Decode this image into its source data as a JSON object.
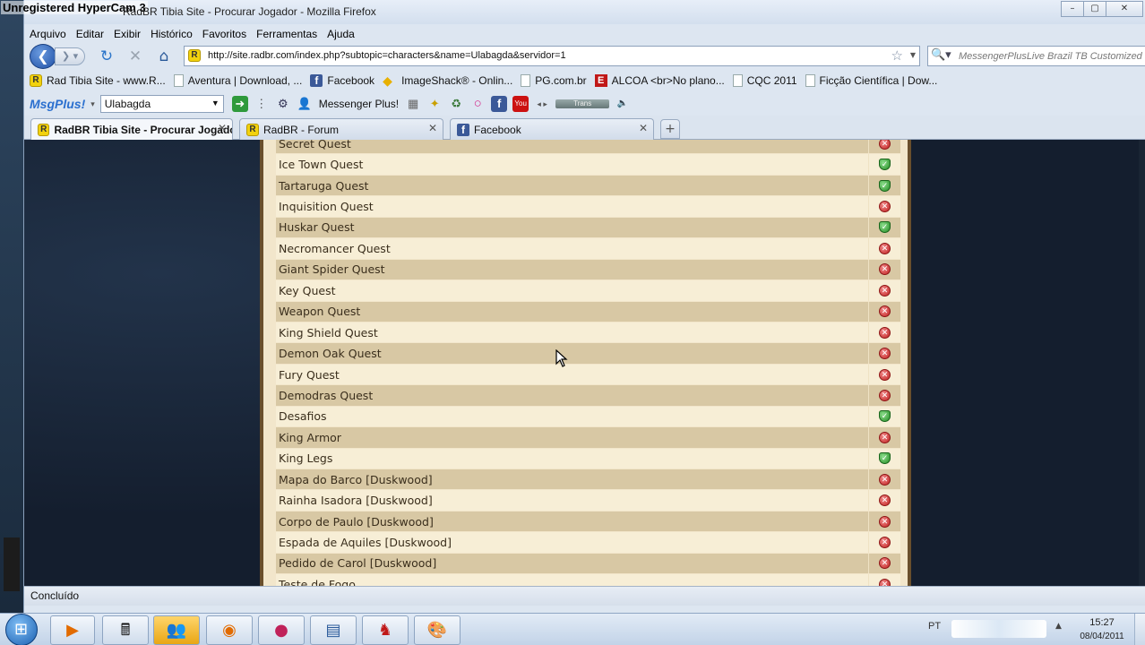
{
  "watermark": "Unregistered HyperCam 3",
  "window": {
    "title": "RadBR Tibia Site - Procurar Jogador - Mozilla Firefox",
    "minimize": "–",
    "maximize": "▢",
    "close": "✕"
  },
  "menu": [
    "Arquivo",
    "Editar",
    "Exibir",
    "Histórico",
    "Favoritos",
    "Ferramentas",
    "Ajuda"
  ],
  "nav": {
    "url": "http://site.radbr.com/index.php?subtopic=characters&name=Ulabagda&servidor=1",
    "search_placeholder": "MessengerPlusLive Brazil TB Customized"
  },
  "bookmarks": [
    {
      "label": "Rad Tibia Site - www.R...",
      "icon": "rad-favicon"
    },
    {
      "label": "Aventura | Download, ...",
      "icon": "page-icon"
    },
    {
      "label": "Facebook",
      "icon": "facebook-icon"
    },
    {
      "label": "ImageShack® - Onlin...",
      "icon": "imageshack-icon"
    },
    {
      "label": "PG.com.br",
      "icon": "page-icon"
    },
    {
      "label": "ALCOA <br>No plano...",
      "icon": "e-icon"
    },
    {
      "label": "CQC 2011",
      "icon": "page-icon"
    },
    {
      "label": "Ficção Científica | Dow...",
      "icon": "page-icon"
    }
  ],
  "msgplus": {
    "logo": "MsgPlus!",
    "search_value": "Ulabagda",
    "messenger_label": "Messenger Plus!",
    "trans_label": "Trans"
  },
  "tabs": [
    {
      "label": "RadBR Tibia Site - Procurar Jogador",
      "active": true
    },
    {
      "label": "RadBR - Forum",
      "active": false
    },
    {
      "label": "Facebook",
      "active": false
    }
  ],
  "quests": [
    {
      "name": "Secret Quest",
      "done": false
    },
    {
      "name": "Ice Town Quest",
      "done": true
    },
    {
      "name": "Tartaruga Quest",
      "done": true
    },
    {
      "name": "Inquisition Quest",
      "done": false
    },
    {
      "name": "Huskar Quest",
      "done": true
    },
    {
      "name": "Necromancer Quest",
      "done": false
    },
    {
      "name": "Giant Spider Quest",
      "done": false
    },
    {
      "name": "Key Quest",
      "done": false
    },
    {
      "name": "Weapon Quest",
      "done": false
    },
    {
      "name": "King Shield Quest",
      "done": false
    },
    {
      "name": "Demon Oak Quest",
      "done": false
    },
    {
      "name": "Fury Quest",
      "done": false
    },
    {
      "name": "Demodras Quest",
      "done": false
    },
    {
      "name": "Desafios",
      "done": true
    },
    {
      "name": "King Armor",
      "done": false
    },
    {
      "name": "King Legs",
      "done": true
    },
    {
      "name": "Mapa do Barco [Duskwood]",
      "done": false
    },
    {
      "name": "Rainha Isadora [Duskwood]",
      "done": false
    },
    {
      "name": "Corpo de Paulo [Duskwood]",
      "done": false
    },
    {
      "name": "Espada de Aquiles [Duskwood]",
      "done": false
    },
    {
      "name": "Pedido de Carol [Duskwood]",
      "done": false
    },
    {
      "name": "Teste de Fogo",
      "done": false
    }
  ],
  "status": "Concluído",
  "taskbar": {
    "lang": "PT",
    "time": "15:27",
    "date": "08/04/2011"
  },
  "colors": {
    "row_odd": "#d8c8a4",
    "row_even": "#f7eed6",
    "done": "#228b22",
    "not_done": "#c22222"
  }
}
